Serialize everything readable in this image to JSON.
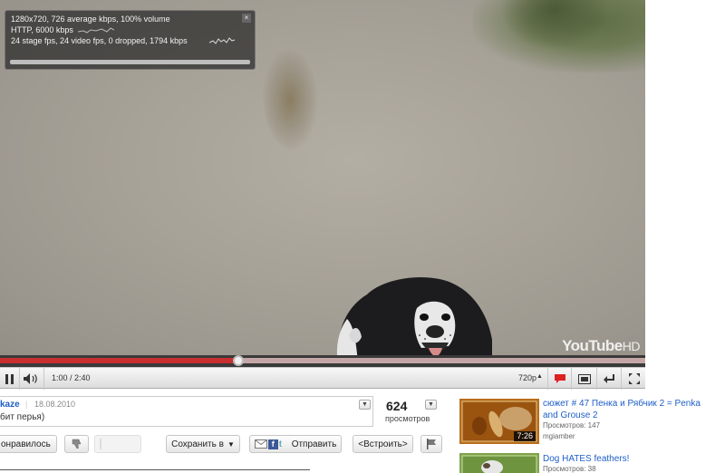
{
  "player": {
    "stats_line1": "1280x720, 726 average kbps, 100% volume",
    "stats_line2": "HTTP, 6000 kbps",
    "stats_line3": "24 stage fps, 24 video fps, 0 dropped, 1794 kbps",
    "stats_close": "×",
    "watermark": "YouTube",
    "watermark_hd": "HD",
    "progress_fraction": 0.37,
    "time": "1:00 / 2:40",
    "quality": "720p"
  },
  "video_info": {
    "uploader": "kaze",
    "date": "18.08.2010",
    "title_fragment": "бит перья)",
    "views_count": "624",
    "views_label": "просмотров"
  },
  "actions": {
    "like_label": "онравилось",
    "save_label": "Сохранить в",
    "share_label": "Отправить",
    "embed_label": "<Встроить>"
  },
  "related": [
    {
      "title": "сюжет # 47 Пенка и Рябчик 2 = Penka and Grouse 2",
      "views": "Просмотров: 147",
      "author": "mgiamber",
      "duration": "7:26"
    },
    {
      "title": "Dog HATES feathers!",
      "views": "Просмотров: 38",
      "author": "",
      "duration": ""
    }
  ],
  "colors": {
    "accent_red": "#c83030",
    "link_blue": "#1e5ec8"
  }
}
